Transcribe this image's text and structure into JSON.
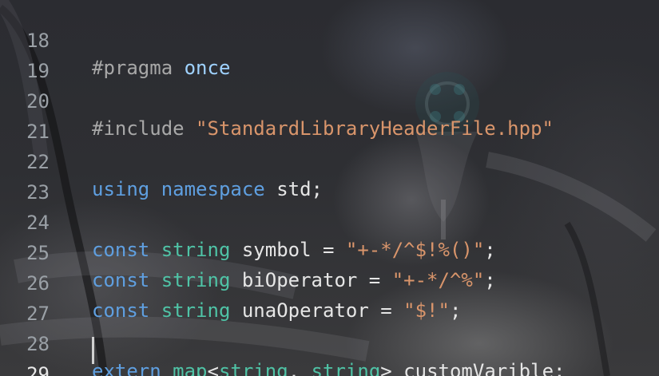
{
  "editor": {
    "lines": [
      {
        "number": "18",
        "tokens": {
          "t1": "#pragma",
          "t2": " ",
          "t3": "once"
        }
      },
      {
        "number": "19"
      },
      {
        "number": "20",
        "tokens": {
          "t1": "#include",
          "t2": " ",
          "t3": "\"StandardLibraryHeaderFile.hpp\""
        }
      },
      {
        "number": "21"
      },
      {
        "number": "22",
        "tokens": {
          "t1": "using",
          "t2": " ",
          "t3": "namespace",
          "t4": " std;"
        }
      },
      {
        "number": "23"
      },
      {
        "number": "24",
        "tokens": {
          "t1": "const",
          "t2": " ",
          "t3": "string",
          "t4": " symbol = ",
          "t5": "\"+-*/^$!%()\"",
          "t6": ";"
        }
      },
      {
        "number": "25",
        "tokens": {
          "t1": "const",
          "t2": " ",
          "t3": "string",
          "t4": " biOperator = ",
          "t5": "\"+-*/^%\"",
          "t6": ";"
        }
      },
      {
        "number": "26",
        "tokens": {
          "t1": "const",
          "t2": " ",
          "t3": "string",
          "t4": " unaOperator = ",
          "t5": "\"$!\"",
          "t6": ";"
        }
      },
      {
        "number": "27"
      },
      {
        "number": "28",
        "tokens": {
          "t1": "extern",
          "t2": " ",
          "t3": "map",
          "t4": "<",
          "t5": "string",
          "t6": ", ",
          "t7": "string",
          "t8": "> customVarible;"
        }
      },
      {
        "number": "29"
      }
    ]
  },
  "colors": {
    "keyword": "#5f9fe0",
    "type": "#4fc3a6",
    "string": "#d9956b",
    "text": "#e6e6e6",
    "line_number": "#9aa0a6",
    "active_line_number": "#e8e8e8"
  }
}
